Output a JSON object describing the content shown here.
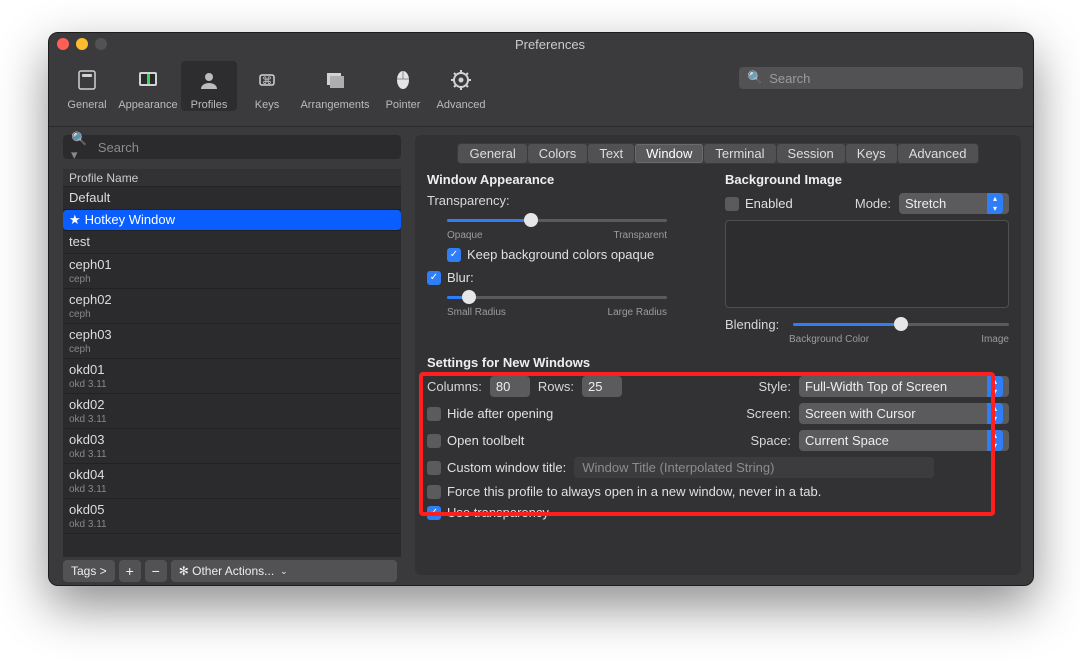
{
  "window": {
    "title": "Preferences"
  },
  "toolbar": {
    "items": [
      "General",
      "Appearance",
      "Profiles",
      "Keys",
      "Arrangements",
      "Pointer",
      "Advanced"
    ],
    "active": "Profiles",
    "search_placeholder": "Search"
  },
  "sidebar": {
    "search_placeholder": "Search",
    "header": "Profile Name",
    "profiles": [
      {
        "name": "Default"
      },
      {
        "name": "Hotkey Window",
        "star": true,
        "selected": true
      },
      {
        "name": "test"
      },
      {
        "name": "ceph01",
        "sub": "ceph"
      },
      {
        "name": "ceph02",
        "sub": "ceph"
      },
      {
        "name": "ceph03",
        "sub": "ceph"
      },
      {
        "name": "okd01",
        "sub": "okd 3.11"
      },
      {
        "name": "okd02",
        "sub": "okd 3.11"
      },
      {
        "name": "okd03",
        "sub": "okd 3.11"
      },
      {
        "name": "okd04",
        "sub": "okd 3.11"
      },
      {
        "name": "okd05",
        "sub": "okd 3.11"
      }
    ],
    "bottom": {
      "tags_label": "Tags >",
      "plus": "+",
      "minus": "−",
      "other_actions": "Other Actions..."
    }
  },
  "tabs": [
    "General",
    "Colors",
    "Text",
    "Window",
    "Terminal",
    "Session",
    "Keys",
    "Advanced"
  ],
  "active_tab": "Window",
  "panel": {
    "win_appearance": "Window Appearance",
    "transparency_label": "Transparency:",
    "transparency_ticks": [
      "Opaque",
      "Transparent"
    ],
    "keep_bg": "Keep background colors opaque",
    "blur_label": "Blur:",
    "blur_ticks": [
      "Small Radius",
      "Large Radius"
    ],
    "bg_image": "Background Image",
    "enabled": "Enabled",
    "mode_label": "Mode:",
    "mode_value": "Stretch",
    "blending_label": "Blending:",
    "blending_ticks": [
      "Background Color",
      "Image"
    ],
    "settings_title": "Settings for New Windows",
    "columns_label": "Columns:",
    "columns_value": "80",
    "rows_label": "Rows:",
    "rows_value": "25",
    "style_label": "Style:",
    "style_value": "Full-Width Top of Screen",
    "hide_after": "Hide after opening",
    "screen_label": "Screen:",
    "screen_value": "Screen with Cursor",
    "open_toolbelt": "Open toolbelt",
    "space_label": "Space:",
    "space_value": "Current Space",
    "custom_title": "Custom window title:",
    "custom_title_ph": "Window Title (Interpolated String)",
    "force_new": "Force this profile to always open in a new window, never in a tab.",
    "use_transp": "Use transparency"
  }
}
